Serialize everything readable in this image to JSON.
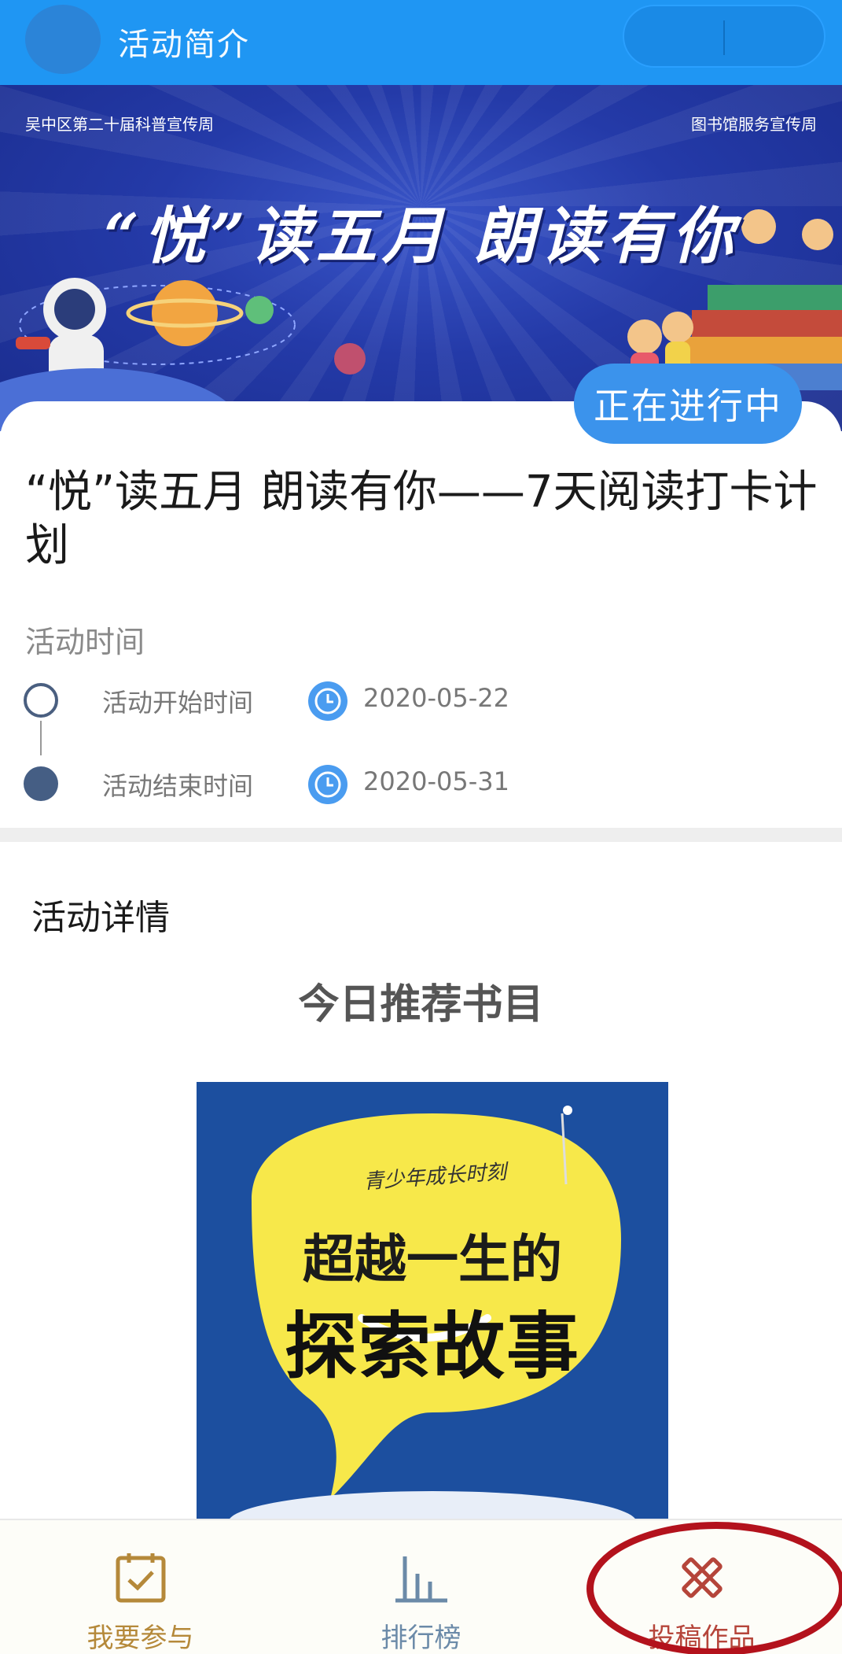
{
  "header": {
    "title": "活动简介",
    "colors": {
      "bar": "#1f96f3"
    }
  },
  "banner": {
    "top_left": "吴中区第二十届科普宣传周",
    "top_right": "图书馆服务宣传周",
    "slogan": "“悦”读五月  朗读有你"
  },
  "status_badge": "正在进行中",
  "activity": {
    "title": "“悦”读五月 朗读有你——7天阅读打卡计划",
    "time_section_label": "活动时间",
    "start": {
      "label": "活动开始时间",
      "date": "2020-05-22"
    },
    "end": {
      "label": "活动结束时间",
      "date": "2020-05-31"
    }
  },
  "details": {
    "label": "活动详情",
    "recommend_title": "今日推荐书目",
    "book": {
      "subtitle": "青少年成长时刻",
      "line1": "超越一生的",
      "line2": "探索故事"
    }
  },
  "bottom_nav": {
    "items": [
      {
        "label": "我要参与",
        "icon": "calendar-check-icon"
      },
      {
        "label": "排行榜",
        "icon": "bar-chart-icon"
      },
      {
        "label": "投稿作品",
        "icon": "pencil-ruler-icon"
      }
    ],
    "colors": {
      "join": "#b5893a",
      "rank": "#6b8aa8",
      "submit": "#b5453a",
      "highlight": "#b3121c"
    }
  }
}
